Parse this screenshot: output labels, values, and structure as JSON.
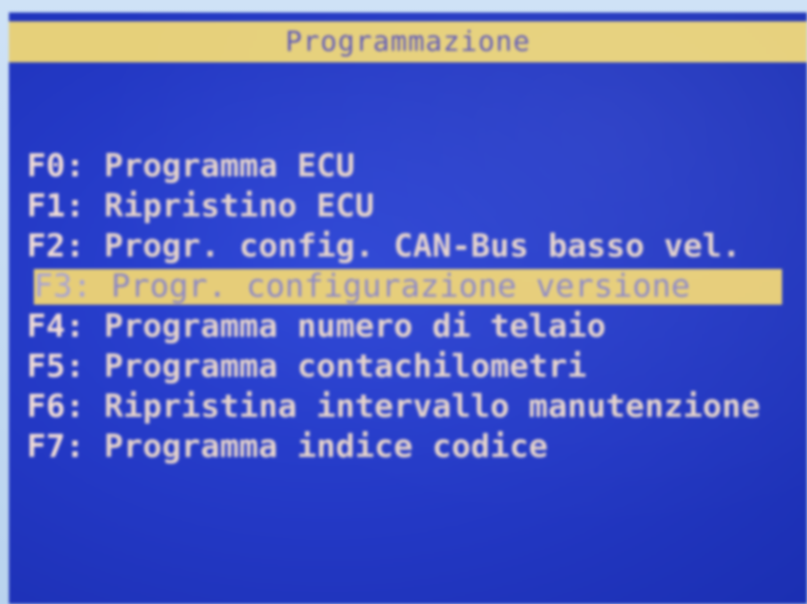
{
  "screen": {
    "title": "Programmazione",
    "colors": {
      "background": "#2338c4",
      "title_bar": "#e6d07a",
      "title_text": "#5a55b8",
      "item_text": "#e4d2cc",
      "selected_bar": "#e6cd78",
      "selected_text": "#8a86c8"
    }
  },
  "menu": {
    "selected_index": 3,
    "items": [
      {
        "key": "F0:",
        "label": "Programma ECU"
      },
      {
        "key": "F1:",
        "label": "Ripristino ECU"
      },
      {
        "key": "F2:",
        "label": "Progr. config. CAN-Bus basso vel."
      },
      {
        "key": "F3:",
        "label": "Progr. configurazione versione"
      },
      {
        "key": "F4:",
        "label": "Programma numero di telaio"
      },
      {
        "key": "F5:",
        "label": "Programma contachilometri"
      },
      {
        "key": "F6:",
        "label": "Ripristina intervallo manutenzione"
      },
      {
        "key": "F7:",
        "label": "Programma indice codice"
      }
    ]
  }
}
